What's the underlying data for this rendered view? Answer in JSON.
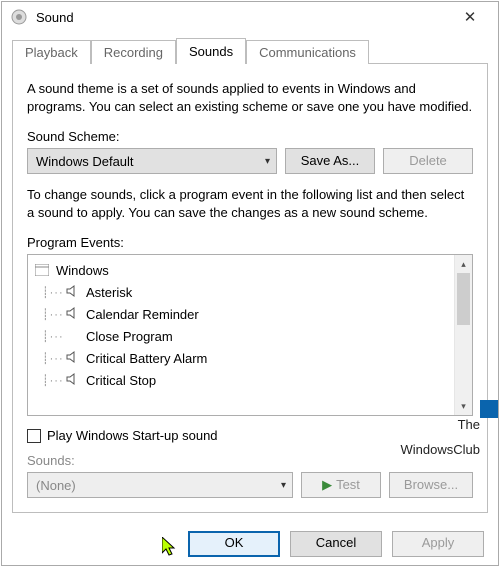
{
  "title": "Sound",
  "tabs": [
    "Playback",
    "Recording",
    "Sounds",
    "Communications"
  ],
  "active_tab": 2,
  "desc1": "A sound theme is a set of sounds applied to events in Windows and programs.  You can select an existing scheme or save one you have modified.",
  "scheme_label": "Sound Scheme:",
  "scheme_value": "Windows Default",
  "save_as": "Save As...",
  "delete": "Delete",
  "desc2": "To change sounds, click a program event in the following list and then select a sound to apply.  You can save the changes as a new sound scheme.",
  "events_label": "Program Events:",
  "events_root": "Windows",
  "events": [
    "Asterisk",
    "Calendar Reminder",
    "Close Program",
    "Critical Battery Alarm",
    "Critical Stop"
  ],
  "play_startup": "Play Windows Start-up sound",
  "sounds_label": "Sounds:",
  "sounds_value": "(None)",
  "test": "Test",
  "browse": "Browse...",
  "ok": "OK",
  "cancel": "Cancel",
  "apply": "Apply",
  "watermark1": "The",
  "watermark2": "WindowsClub"
}
